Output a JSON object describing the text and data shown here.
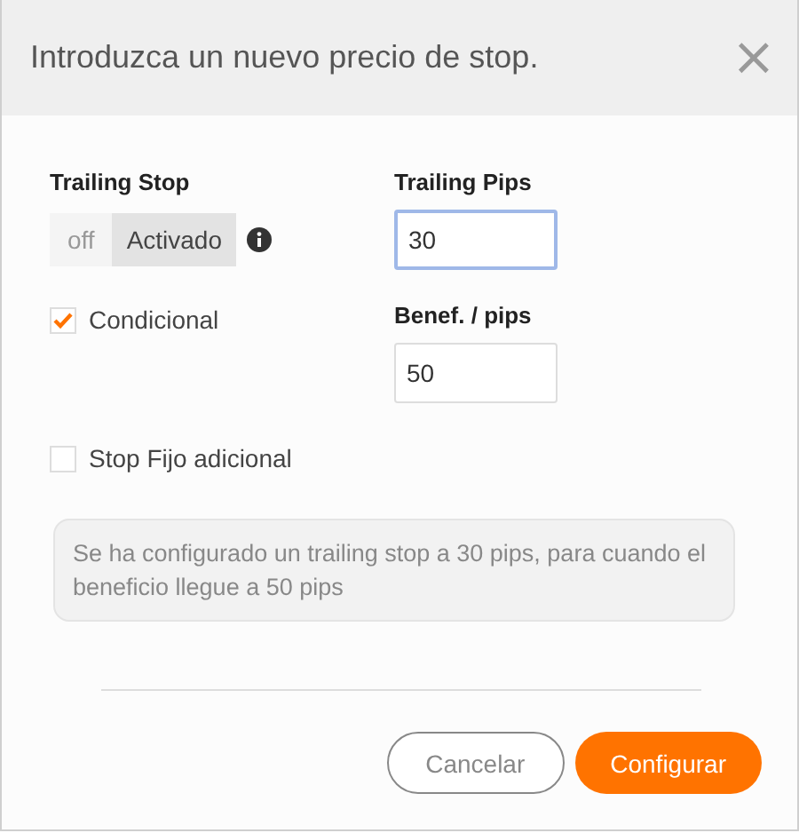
{
  "dialog": {
    "title": "Introduzca un nuevo precio de stop.",
    "close": "×"
  },
  "trailing_stop": {
    "label": "Trailing Stop",
    "options": [
      {
        "label": "off",
        "selected": false
      },
      {
        "label": "Activado",
        "selected": true
      }
    ]
  },
  "conditional": {
    "label": "Condicional",
    "checked": true
  },
  "trailing_pips": {
    "label": "Trailing Pips",
    "value": "30",
    "focused": true
  },
  "profit_pips": {
    "label": "Benef. / pips",
    "value": "50",
    "focused": false
  },
  "fixed_stop": {
    "label": "Stop Fijo adicional",
    "checked": false
  },
  "summary": "Se ha configurado un trailing stop a 30 pips, para cuando el beneficio llegue a 50 pips",
  "buttons": [
    {
      "label": "Cancelar",
      "kind": "secondary"
    },
    {
      "label": "Configurar",
      "kind": "primary"
    }
  ]
}
